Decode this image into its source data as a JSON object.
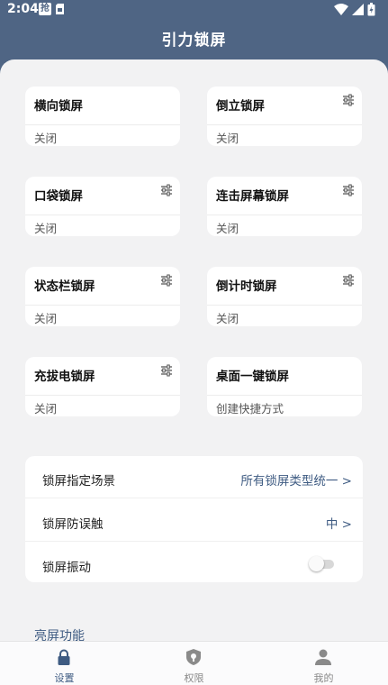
{
  "status_bar": {
    "time": "2:04",
    "notification_icon_text": "抢"
  },
  "header": {
    "title": "引力锁屏"
  },
  "cards": [
    {
      "title": "横向锁屏",
      "status": "关闭",
      "has_settings_icon": false
    },
    {
      "title": "倒立锁屏",
      "status": "关闭",
      "has_settings_icon": true
    },
    {
      "title": "口袋锁屏",
      "status": "关闭",
      "has_settings_icon": true
    },
    {
      "title": "连击屏幕锁屏",
      "status": "关闭",
      "has_settings_icon": true
    },
    {
      "title": "状态栏锁屏",
      "status": "关闭",
      "has_settings_icon": true
    },
    {
      "title": "倒计时锁屏",
      "status": "关闭",
      "has_settings_icon": true
    },
    {
      "title": "充拔电锁屏",
      "status": "关闭",
      "has_settings_icon": true
    },
    {
      "title": "桌面一键锁屏",
      "status": "创建快捷方式",
      "has_settings_icon": false
    }
  ],
  "settings": {
    "scene_label": "锁屏指定场景",
    "scene_value": "所有锁屏类型统一 >",
    "mistouch_label": "锁屏防误触",
    "mistouch_value": "中 >",
    "vibration_label": "锁屏振动",
    "vibration_on": false
  },
  "section": {
    "title": "亮屏功能"
  },
  "bottom_nav": {
    "items": [
      {
        "label": "设置",
        "icon": "lock-icon",
        "active": true
      },
      {
        "label": "权限",
        "icon": "shield-key-icon",
        "active": false
      },
      {
        "label": "我的",
        "icon": "person-icon",
        "active": false
      }
    ]
  },
  "colors": {
    "header_bg": "#4f6584",
    "accent": "#3e5b82",
    "sheet_bg": "#f2f2f3"
  }
}
